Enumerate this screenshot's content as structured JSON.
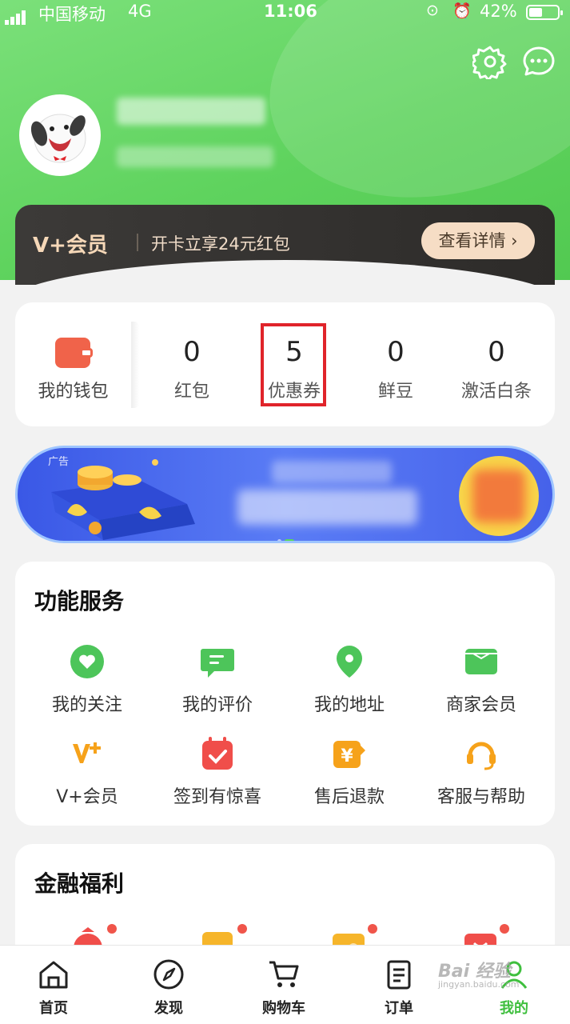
{
  "status_bar": {
    "carrier": "中国移动",
    "network": "4G",
    "time": "11:06",
    "battery": "42%",
    "battery_level": 0.42
  },
  "header": {
    "icons": [
      "gear-icon",
      "message-icon"
    ]
  },
  "vip_banner": {
    "logo": "V+会员",
    "text": "开卡立享24元红包",
    "button": "查看详情 ›"
  },
  "assets": {
    "wallet_label": "我的钱包",
    "items": [
      {
        "value": "0",
        "label": "红包"
      },
      {
        "value": "5",
        "label": "优惠券"
      },
      {
        "value": "0",
        "label": "鲜豆"
      },
      {
        "value": "0",
        "label": "激活白条"
      }
    ]
  },
  "ad": {
    "tag": "广告"
  },
  "services": {
    "title": "功能服务",
    "items": [
      {
        "label": "我的关注",
        "icon": "heart-icon"
      },
      {
        "label": "我的评价",
        "icon": "comment-icon"
      },
      {
        "label": "我的地址",
        "icon": "location-icon"
      },
      {
        "label": "商家会员",
        "icon": "card-icon"
      },
      {
        "label": "V+会员",
        "icon": "vplus-icon"
      },
      {
        "label": "签到有惊喜",
        "icon": "calendar-check-icon"
      },
      {
        "label": "售后退款",
        "icon": "refund-icon"
      },
      {
        "label": "客服与帮助",
        "icon": "headset-icon"
      }
    ]
  },
  "finance": {
    "title": "金融福利"
  },
  "tabbar": {
    "items": [
      {
        "label": "首页",
        "icon": "home-icon"
      },
      {
        "label": "发现",
        "icon": "compass-icon"
      },
      {
        "label": "购物车",
        "icon": "cart-icon"
      },
      {
        "label": "订单",
        "icon": "order-icon"
      },
      {
        "label": "我的",
        "icon": "user-icon"
      }
    ],
    "active": "我的"
  },
  "colors": {
    "brand_green": "#52c951",
    "highlight_red": "#e0242a"
  },
  "watermark": {
    "text": "Bai 经验",
    "sub": "jingyan.baidu.com"
  }
}
